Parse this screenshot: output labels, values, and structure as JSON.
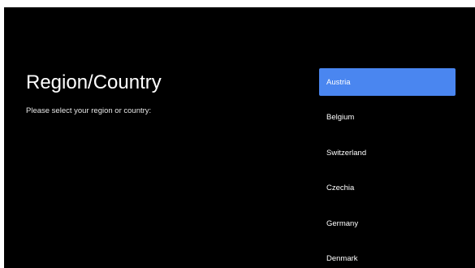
{
  "page": {
    "title": "Region/Country",
    "subtitle": "Please select your region or country:"
  },
  "countries": {
    "items": [
      {
        "label": "Austria",
        "selected": true
      },
      {
        "label": "Belgium",
        "selected": false
      },
      {
        "label": "Switzerland",
        "selected": false
      },
      {
        "label": "Czechia",
        "selected": false
      },
      {
        "label": "Germany",
        "selected": false
      },
      {
        "label": "Denmark",
        "selected": false
      }
    ]
  },
  "colors": {
    "background": "#000000",
    "selection": "#4a86f0",
    "text": "#ffffff"
  }
}
